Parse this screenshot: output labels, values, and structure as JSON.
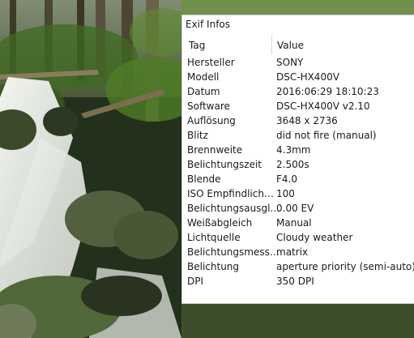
{
  "panel": {
    "title": "Exif Infos",
    "columns": {
      "tag": "Tag",
      "value": "Value"
    },
    "rows": [
      {
        "tag": "Hersteller",
        "value": "SONY"
      },
      {
        "tag": "Modell",
        "value": "DSC-HX400V"
      },
      {
        "tag": "Datum",
        "value": "2016:06:29 18:10:23"
      },
      {
        "tag": "Software",
        "value": "DSC-HX400V v2.10"
      },
      {
        "tag": "Auflösung",
        "value": "3648 x 2736"
      },
      {
        "tag": "Blitz",
        "value": "did not fire (manual)"
      },
      {
        "tag": "Brennweite",
        "value": "4.3mm"
      },
      {
        "tag": "Belichtungszeit",
        "value": "2.500s"
      },
      {
        "tag": "Blende",
        "value": "F4.0"
      },
      {
        "tag": "ISO Empfindlich…",
        "value": "100"
      },
      {
        "tag": "Belichtungsausgl…",
        "value": "0.00 EV"
      },
      {
        "tag": "Weißabgleich",
        "value": "Manual"
      },
      {
        "tag": "Lichtquelle",
        "value": "Cloudy weather"
      },
      {
        "tag": "Belichtungsmess…",
        "value": "matrix"
      },
      {
        "tag": "Belichtung",
        "value": "aperture priority (semi-auto)"
      },
      {
        "tag": "DPI",
        "value": "350 DPI"
      }
    ]
  }
}
